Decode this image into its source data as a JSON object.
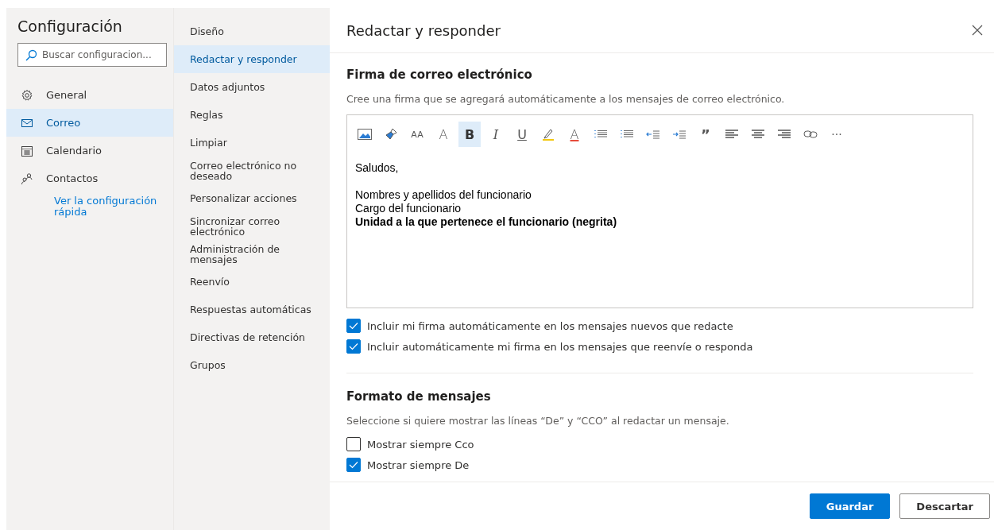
{
  "sidebar": {
    "title": "Configuración",
    "search": {
      "placeholder": "Buscar configuracion..."
    },
    "items": [
      {
        "kind": "gear",
        "label": "General",
        "selected": false
      },
      {
        "kind": "mail",
        "label": "Correo",
        "selected": true
      },
      {
        "kind": "calendar",
        "label": "Calendario",
        "selected": false
      },
      {
        "kind": "people",
        "label": "Contactos",
        "selected": false
      }
    ],
    "link": "Ver la configuración rápida"
  },
  "subnav": [
    {
      "label": "Diseño",
      "selected": false
    },
    {
      "label": "Redactar y responder",
      "selected": true
    },
    {
      "label": "Datos adjuntos",
      "selected": false
    },
    {
      "label": "Reglas",
      "selected": false
    },
    {
      "label": "Limpiar",
      "selected": false
    },
    {
      "label": "Correo electrónico no deseado",
      "selected": false
    },
    {
      "label": "Personalizar acciones",
      "selected": false
    },
    {
      "label": "Sincronizar correo electrónico",
      "selected": false
    },
    {
      "label": "Administración de mensajes",
      "selected": false
    },
    {
      "label": "Reenvío",
      "selected": false
    },
    {
      "label": "Respuestas automáticas",
      "selected": false
    },
    {
      "label": "Directivas de retención",
      "selected": false
    },
    {
      "label": "Grupos",
      "selected": false
    }
  ],
  "panel": {
    "title": "Redactar y responder",
    "signature": {
      "heading": "Firma de correo electrónico",
      "description": "Cree una firma que se agregará automáticamente a los mensajes de correo electrónico.",
      "toolbar": [
        {
          "kind": "image"
        },
        {
          "kind": "brush"
        },
        {
          "kind": "fontsize",
          "label": "AA"
        },
        {
          "kind": "grow",
          "label": "A"
        },
        {
          "kind": "bold",
          "label": "B",
          "selected": true
        },
        {
          "kind": "italic",
          "label": "I",
          "selected": false
        },
        {
          "kind": "underline",
          "label": "U",
          "selected": false
        },
        {
          "kind": "highlight"
        },
        {
          "kind": "color",
          "label": "A"
        },
        {
          "kind": "bullets"
        },
        {
          "kind": "numbers"
        },
        {
          "kind": "outdent"
        },
        {
          "kind": "indent"
        },
        {
          "kind": "quote",
          "label": "”"
        },
        {
          "kind": "left"
        },
        {
          "kind": "center"
        },
        {
          "kind": "right"
        },
        {
          "kind": "link"
        },
        {
          "kind": "more",
          "label": "···"
        }
      ],
      "paragraphs": [
        [
          {
            "text": "Saludos,",
            "bold": false
          }
        ],
        [
          {
            "text": "Nombres y apellidos del funcionario",
            "bold": false
          },
          {
            "text": "Cargo del funcionario",
            "bold": false
          },
          {
            "text": "Unidad a la que pertenece el funcionario (negrita)",
            "bold": true
          }
        ]
      ],
      "options": [
        {
          "label": "Incluir mi firma automáticamente en los mensajes nuevos que redacte",
          "checked": true
        },
        {
          "label": "Incluir automáticamente mi firma en los mensajes que reenvíe o responda",
          "checked": true
        }
      ]
    },
    "format": {
      "heading": "Formato de mensajes",
      "description": "Seleccione si quiere mostrar las líneas “De” y “CCO” al redactar un mensaje.",
      "options": [
        {
          "label": "Mostrar siempre Cco",
          "checked": false
        },
        {
          "label": "Mostrar siempre De",
          "checked": true
        }
      ]
    },
    "buttons": [
      {
        "label": "Guardar",
        "kind": "primary"
      },
      {
        "label": "Descartar",
        "kind": "secondary"
      }
    ]
  }
}
